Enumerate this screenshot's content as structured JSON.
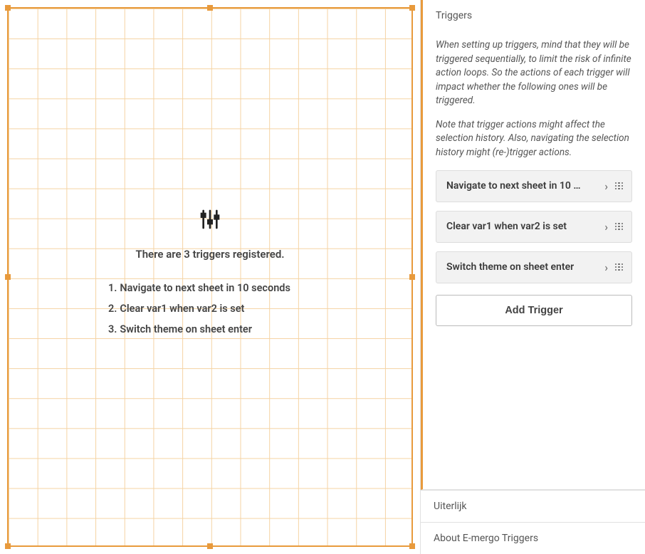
{
  "canvas": {
    "summary": "There are 3 triggers registered.",
    "items": [
      "Navigate to next sheet in 10 seconds",
      "Clear var1 when var2 is set",
      "Switch theme on sheet enter"
    ]
  },
  "panel": {
    "sections": {
      "triggers": "Triggers",
      "appearance": "Uiterlijk",
      "about": "About E-mergo Triggers"
    },
    "help1": "When setting up triggers, mind that they will be triggered sequentially, to limit the risk of infinite action loops. So the actions of each trigger will impact whether the following ones will be triggered.",
    "help2": "Note that trigger actions might affect the selection history. Also, navigating the selection history might (re-)trigger actions.",
    "cards": [
      "Navigate to next sheet in 10 …",
      "Clear var1 when var2 is set",
      "Switch theme on sheet enter"
    ],
    "add_label": "Add Trigger"
  }
}
